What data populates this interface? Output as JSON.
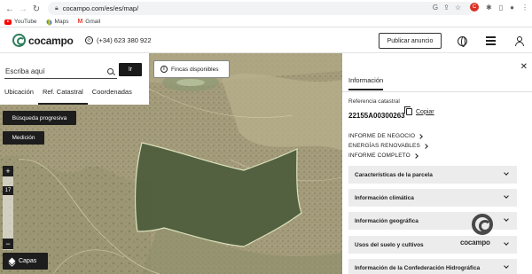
{
  "browser": {
    "url": "cocampo.com/es/es/map/",
    "profile_initial": "C",
    "bookmarks": [
      "YouTube",
      "Maps",
      "Gmail"
    ]
  },
  "header": {
    "logo_text": "cocampo",
    "phone": "(+34) 623 380 922",
    "publish_label": "Publicar anuncio",
    "brand_color": "#2e7d5b"
  },
  "search": {
    "placeholder": "Escriba aquí",
    "go_label": "Ir",
    "tabs": [
      "Ubicación",
      "Ref. Catastral",
      "Coordenadas"
    ],
    "active_tab": "Ref. Catastral"
  },
  "map": {
    "fincas_label": "Fincas disponibles",
    "busqueda_label": "Búsqueda progresiva",
    "medicion_label": "Medición",
    "zoom_plus": "+",
    "zoom_level": "17",
    "zoom_minus": "−",
    "capas_label": "Capas"
  },
  "panel": {
    "tab_label": "Información",
    "ref_label": "Referencia catastral",
    "ref_value": "22155A00300263",
    "copy_label": "Copiar",
    "links": [
      "INFORME DE NEGOCIO",
      "ENERGÍAS RENOVABLES",
      "INFORME COMPLETO"
    ],
    "sections": [
      "Características de la parcela",
      "Información climática",
      "Información geográfica",
      "Usos del suelo y cultivos",
      "Información de la Confederación Hidrográfica"
    ],
    "watermark_text": "cocampo"
  }
}
